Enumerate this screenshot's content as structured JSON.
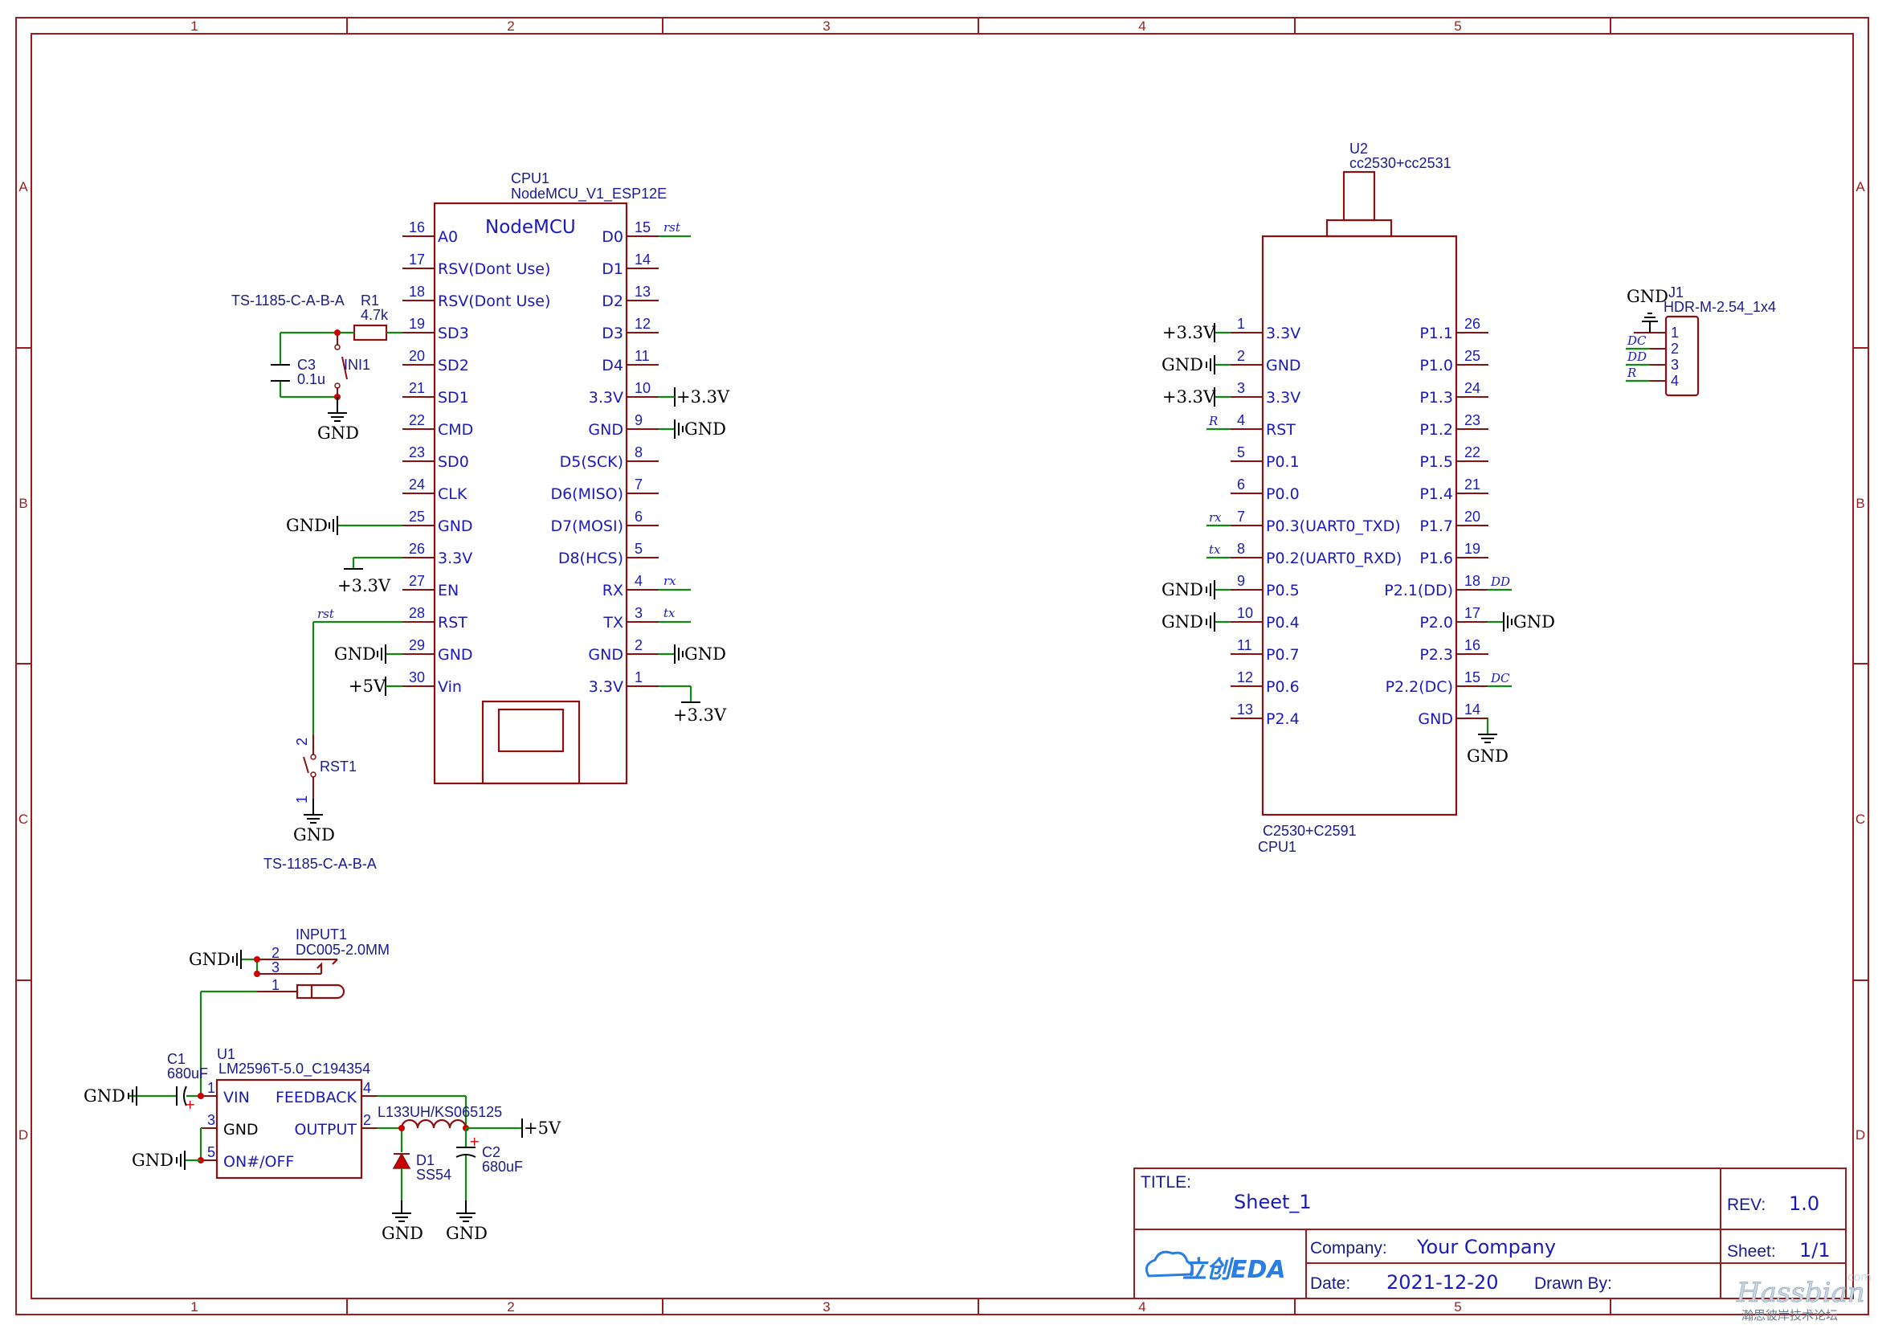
{
  "frame": {
    "columns": [
      "1",
      "2",
      "3",
      "4",
      "5"
    ],
    "rows": [
      "A",
      "B",
      "C",
      "D"
    ]
  },
  "nodemcu": {
    "ref": "CPU1",
    "part": "NodeMCU_V1_ESP12E",
    "title": "NodeMCU",
    "left_pins": [
      {
        "num": "16",
        "name": "A0"
      },
      {
        "num": "17",
        "name": "RSV(Dont Use)"
      },
      {
        "num": "18",
        "name": "RSV(Dont Use)"
      },
      {
        "num": "19",
        "name": "SD3"
      },
      {
        "num": "20",
        "name": "SD2"
      },
      {
        "num": "21",
        "name": "SD1"
      },
      {
        "num": "22",
        "name": "CMD"
      },
      {
        "num": "23",
        "name": "SD0"
      },
      {
        "num": "24",
        "name": "CLK"
      },
      {
        "num": "25",
        "name": "GND"
      },
      {
        "num": "26",
        "name": "3.3V"
      },
      {
        "num": "27",
        "name": "EN"
      },
      {
        "num": "28",
        "name": "RST"
      },
      {
        "num": "29",
        "name": "GND"
      },
      {
        "num": "30",
        "name": "Vin"
      }
    ],
    "right_pins": [
      {
        "num": "15",
        "name": "D0"
      },
      {
        "num": "14",
        "name": "D1"
      },
      {
        "num": "13",
        "name": "D2"
      },
      {
        "num": "12",
        "name": "D3"
      },
      {
        "num": "11",
        "name": "D4"
      },
      {
        "num": "10",
        "name": "3.3V"
      },
      {
        "num": "9",
        "name": "GND"
      },
      {
        "num": "8",
        "name": "D5(SCK)"
      },
      {
        "num": "7",
        "name": "D6(MISO)"
      },
      {
        "num": "6",
        "name": "D7(MOSI)"
      },
      {
        "num": "5",
        "name": "D8(HCS)"
      },
      {
        "num": "4",
        "name": "RX"
      },
      {
        "num": "3",
        "name": "TX"
      },
      {
        "num": "2",
        "name": "GND"
      },
      {
        "num": "1",
        "name": "3.3V"
      }
    ]
  },
  "cc2530": {
    "ref": "U2",
    "part": "cc2530+cc2531",
    "bottom_name": "C2530+C2591",
    "bottom_ref": "CPU1",
    "left_pins": [
      {
        "num": "1",
        "name": "3.3V"
      },
      {
        "num": "2",
        "name": "GND"
      },
      {
        "num": "3",
        "name": "3.3V"
      },
      {
        "num": "4",
        "name": "RST"
      },
      {
        "num": "5",
        "name": "P0.1"
      },
      {
        "num": "6",
        "name": "P0.0"
      },
      {
        "num": "7",
        "name": "P0.3(UART0_TXD)"
      },
      {
        "num": "8",
        "name": "P0.2(UART0_RXD)"
      },
      {
        "num": "9",
        "name": "P0.5"
      },
      {
        "num": "10",
        "name": "P0.4"
      },
      {
        "num": "11",
        "name": "P0.7"
      },
      {
        "num": "12",
        "name": "P0.6"
      },
      {
        "num": "13",
        "name": "P2.4"
      }
    ],
    "right_pins": [
      {
        "num": "26",
        "name": "P1.1"
      },
      {
        "num": "25",
        "name": "P1.0"
      },
      {
        "num": "24",
        "name": "P1.3"
      },
      {
        "num": "23",
        "name": "P1.2"
      },
      {
        "num": "22",
        "name": "P1.5"
      },
      {
        "num": "21",
        "name": "P1.4"
      },
      {
        "num": "20",
        "name": "P1.7"
      },
      {
        "num": "19",
        "name": "P1.6"
      },
      {
        "num": "18",
        "name": "P2.1(DD)"
      },
      {
        "num": "17",
        "name": "P2.0"
      },
      {
        "num": "16",
        "name": "P2.3"
      },
      {
        "num": "15",
        "name": "P2.2(DC)"
      },
      {
        "num": "14",
        "name": "GND"
      }
    ]
  },
  "header": {
    "ref": "J1",
    "part": "HDR-M-2.54_1x4",
    "pins": [
      "1",
      "2",
      "3",
      "4"
    ],
    "nets": [
      "GND",
      "DC",
      "DD",
      "R"
    ]
  },
  "sw_ini": {
    "ref": "INI1",
    "part": "TS-1185-C-A-B-A"
  },
  "sw_rst": {
    "ref": "RST1",
    "part": "TS-1185-C-A-B-A",
    "pin_top": "2",
    "pin_bot": "1"
  },
  "r1": {
    "ref": "R1",
    "value": "4.7k"
  },
  "c3": {
    "ref": "C3",
    "value": "0.1u"
  },
  "input": {
    "ref": "INPUT1",
    "part": "DC005-2.0MM",
    "pins": [
      "2",
      "3",
      "1"
    ]
  },
  "regulator": {
    "ref": "U1",
    "part": "LM2596T-5.0_C194354",
    "pins": [
      {
        "num": "1",
        "name": "VIN"
      },
      {
        "num": "3",
        "name": "GND"
      },
      {
        "num": "5",
        "name": "ON#/OFF"
      },
      {
        "num": "4",
        "name": "FEEDBACK"
      },
      {
        "num": "2",
        "name": "OUTPUT"
      }
    ]
  },
  "c1": {
    "ref": "C1",
    "value": "680uF"
  },
  "c2": {
    "ref": "C2",
    "value": "680uF"
  },
  "inductor": {
    "label": "L133UH/KS065125"
  },
  "d1": {
    "ref": "D1",
    "part": "SS54"
  },
  "power": {
    "gnd": "GND",
    "v33": "+3.3V",
    "v5": "+5V"
  },
  "nets": {
    "rst": "rst",
    "rx": "rx",
    "tx": "tx",
    "R": "R",
    "DD": "DD",
    "DC": "DC"
  },
  "title_block": {
    "title_label": "TITLE:",
    "title": "Sheet_1",
    "rev_label": "REV:",
    "rev": "1.0",
    "company_label": "Company:",
    "company": "Your Company",
    "sheet_label": "Sheet:",
    "sheet": "1/1",
    "date_label": "Date:",
    "date": "2021-12-20",
    "drawn_label": "Drawn By:",
    "logo": "立创EDA"
  },
  "watermark": {
    "brand": "Hassbian",
    "sub": "瀚思彼岸技术论坛",
    "domain": "com"
  }
}
